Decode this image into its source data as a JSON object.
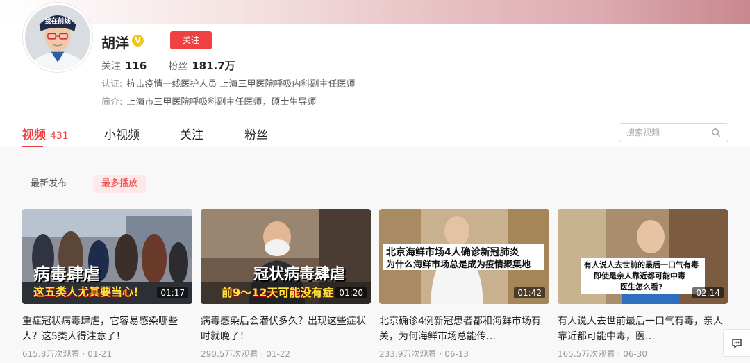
{
  "profile": {
    "name": "胡洋",
    "verify_badge": "V",
    "follow_label": "关注",
    "avatar_hat_text": "我在前线",
    "following_label": "关注",
    "following_count": "116",
    "followers_label": "粉丝",
    "followers_count": "181.7万",
    "cert_label": "认证:",
    "cert_value": "抗击疫情一线医护人员 上海三甲医院呼吸内科副主任医师",
    "bio_label": "简介:",
    "bio_value": "上海市三甲医院呼吸科副主任医师，硕士生导师。"
  },
  "tabs": [
    {
      "label": "视频",
      "count": "431"
    },
    {
      "label": "小视频"
    },
    {
      "label": "关注"
    },
    {
      "label": "粉丝"
    }
  ],
  "search": {
    "placeholder": "搜索视频",
    "icon": "search-icon"
  },
  "filters": [
    {
      "label": "最新发布"
    },
    {
      "label": "最多播放"
    }
  ],
  "videos": [
    {
      "title": "重症冠状病毒肆虐，它容易感染哪些人？这5类人得注意了！",
      "duration": "01:17",
      "views": "615.8万次观看",
      "date": "01-21",
      "caption_main": "病毒肆虐",
      "caption_sub": "这五类人尤其要当心!"
    },
    {
      "title": "病毒感染后会潜伏多久？出现这些症状时就晚了！",
      "duration": "01:20",
      "views": "290.5万次观看",
      "date": "01-22",
      "caption_main": "冠状病毒肆虐",
      "caption_sub": "前9～12天可能没有症"
    },
    {
      "title": "北京确诊4例新冠患者都和海鲜市场有关，为何海鲜市场总能传…",
      "duration": "01:42",
      "views": "233.9万次观看",
      "date": "06-13",
      "caption_main": "北京海鲜市场4人确诊新冠肺炎",
      "caption_sub": "为什么海鲜市场总是成为疫情聚集地"
    },
    {
      "title": "有人说人去世前最后一口气有毒，亲人靠近都可能中毒，医…",
      "duration": "02:14",
      "views": "165.5万次观看",
      "date": "06-30",
      "caption_main": "有人说人去世前的最后一口气有毒",
      "caption_sub": "即使是亲人靠近都可能中毒",
      "caption_sub2": "医生怎么看?"
    }
  ],
  "meta_separator": "·",
  "colors": {
    "accent": "#f04142",
    "verify": "#f3c518"
  }
}
